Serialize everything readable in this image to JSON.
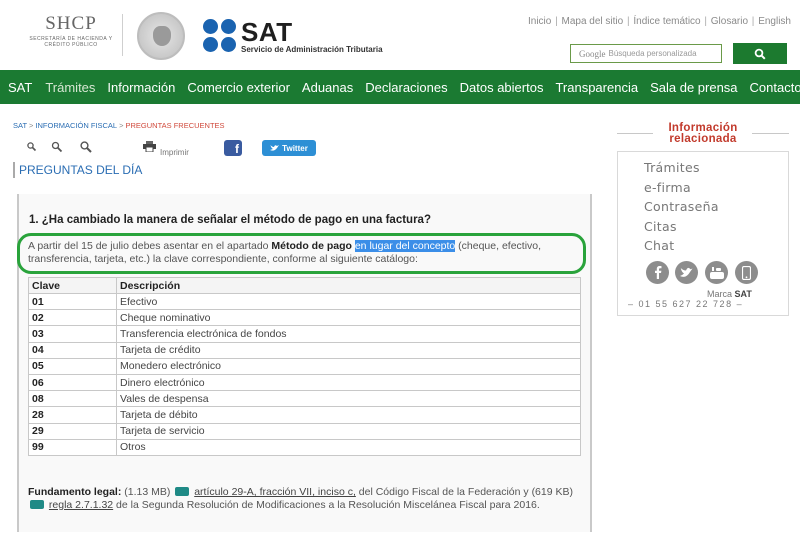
{
  "header": {
    "shcp_logo_text": "SHCP",
    "shcp_logo_sub": "Secretaría de Hacienda y Crédito Público",
    "sat_logo_text": "SAT",
    "sat_logo_sub": "Servicio de Administración Tributaria",
    "top_links": [
      "Inicio",
      "Mapa del sitio",
      "Índice temático",
      "Glosario",
      "English"
    ],
    "search": {
      "brand": "Google",
      "placeholder": "Búsqueda personalizada"
    }
  },
  "nav": {
    "items": [
      "SAT",
      "Trámites",
      "Información",
      "Comercio exterior",
      "Aduanas",
      "Declaraciones",
      "Datos abiertos",
      "Transparencia",
      "Sala de prensa",
      "Contacto"
    ],
    "active": "Trámites"
  },
  "breadcrumb": [
    "SAT",
    "INFORMACIÓN FISCAL",
    "PREGUNTAS FRECUENTES"
  ],
  "tools": {
    "print_label": "Imprimir",
    "facebook_glyph": "f",
    "twitter_label": "Twitter"
  },
  "section_title": "PREGUNTAS DEL DÍA",
  "question": {
    "title": "1. ¿Ha cambiado la manera de señalar el método de pago en una factura?",
    "answer_part1": "A partir del 15 de julio debes asentar en el apartado ",
    "answer_bold": "Método de pago",
    "answer_highlight": "en lugar del concepto",
    "answer_part2": " (cheque, efectivo, transferencia, tarjeta, etc.) la clave correspondiente, conforme al siguiente catálogo:"
  },
  "catalog": {
    "headers": [
      "Clave",
      "Descripción"
    ],
    "rows": [
      [
        "01",
        "Efectivo"
      ],
      [
        "02",
        "Cheque nominativo"
      ],
      [
        "03",
        "Transferencia electrónica de fondos"
      ],
      [
        "04",
        "Tarjeta de crédito"
      ],
      [
        "05",
        "Monedero electrónico"
      ],
      [
        "06",
        "Dinero electrónico"
      ],
      [
        "08",
        "Vales de despensa"
      ],
      [
        "28",
        "Tarjeta de débito"
      ],
      [
        "29",
        "Tarjeta de servicio"
      ],
      [
        "99",
        "Otros"
      ]
    ]
  },
  "fundamento": {
    "label": "Fundamento legal:",
    "size1": "(1.13 MB)",
    "link1": "artículo 29-A, fracción VII, inciso c,",
    "text1": " del Código Fiscal de la Federación y ",
    "size2": "(619 KB)",
    "link2": "regla 2.7.1.32",
    "text2": " de la Segunda Resolución de Modificaciones a la Resolución Miscelánea Fiscal para 2016."
  },
  "right_panel": {
    "title_line1": "Información",
    "title_line2": "relacionada",
    "links": [
      "Trámites",
      "e-firma",
      "Contraseña",
      "Citas",
      "Chat"
    ],
    "marca_prefix": "Marca ",
    "marca_bold": "SAT",
    "phone": "–   01 55 627 22 728   –"
  },
  "colors": {
    "nav_bg": "#1b7a32",
    "link_blue": "#2a6db3",
    "accent_red": "#c23a2c",
    "highlight_ring": "#29a33b"
  }
}
